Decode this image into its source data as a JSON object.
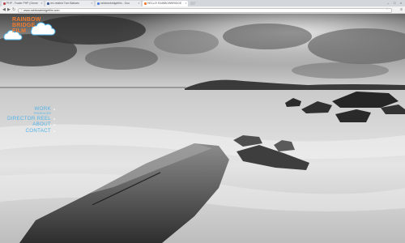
{
  "browser": {
    "tabs": [
      {
        "label": "PHP - Foster PHP (Genre",
        "active": false
      },
      {
        "label": "rex.related Tom Balkwin",
        "active": false
      },
      {
        "label": "rainbowbridgefilm - Goo",
        "active": false
      },
      {
        "label": "HELLO! RAINBOWBRIDGE",
        "active": true
      }
    ],
    "url": "www.rainbowbridgefilm.com"
  },
  "site": {
    "logo": {
      "line1": "RAINBOW",
      "line2": "BRIDGE",
      "line3": "FILM"
    },
    "nav": {
      "work": "WORK",
      "work_sub": "PRODUCER",
      "director_reel": "DIRECTOR REEL",
      "about": "ABOUT",
      "contact": "CONTACT"
    }
  },
  "colors": {
    "logo_text": "#f07b2e",
    "nav_text": "#4fb2e8"
  }
}
